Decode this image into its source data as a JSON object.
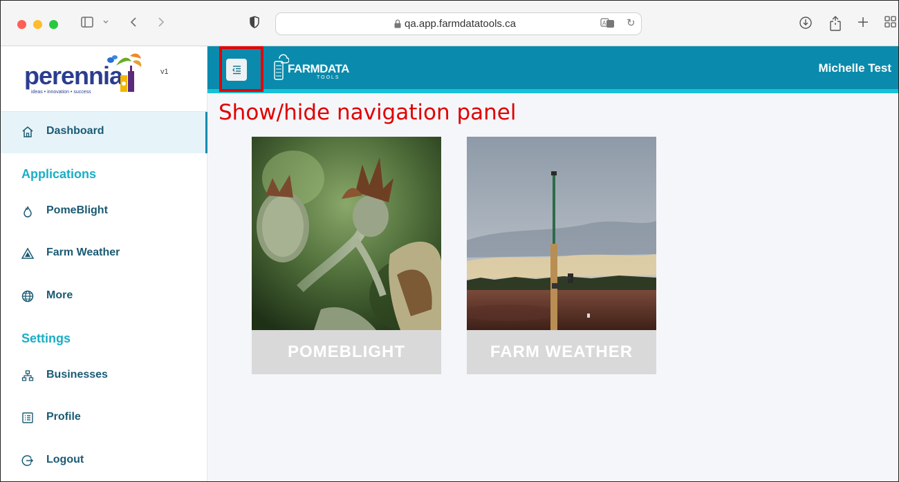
{
  "browser": {
    "url": "qa.app.farmdatatools.ca",
    "translate_glyph": "㮭",
    "reload_glyph": "↻"
  },
  "sidebar": {
    "brand": "perennia",
    "tagline": "ideas • innovation • success",
    "version": "v1",
    "dashboard": "Dashboard",
    "sections": {
      "applications": "Applications",
      "settings": "Settings"
    },
    "applications": [
      {
        "label": "PomeBlight",
        "icon": "flame-icon"
      },
      {
        "label": "Farm Weather",
        "icon": "triangle-icon"
      },
      {
        "label": "More",
        "icon": "globe-icon"
      }
    ],
    "settings": [
      {
        "label": "Businesses",
        "icon": "hierarchy-icon"
      },
      {
        "label": "Profile",
        "icon": "profile-list-icon"
      },
      {
        "label": "Logout",
        "icon": "logout-icon"
      }
    ]
  },
  "header": {
    "logo_word": "FARMDATA",
    "logo_sub": "TOOLS",
    "user": "Michelle Test"
  },
  "annotation": "Show/hide navigation panel",
  "cards": [
    {
      "label": "POMEBLIGHT"
    },
    {
      "label": "FARM WEATHER"
    }
  ],
  "colors": {
    "header": "#0a8bad",
    "header_stripe": "#16c2d5",
    "accent_text": "#1aaec5",
    "annotation": "#e60000"
  }
}
